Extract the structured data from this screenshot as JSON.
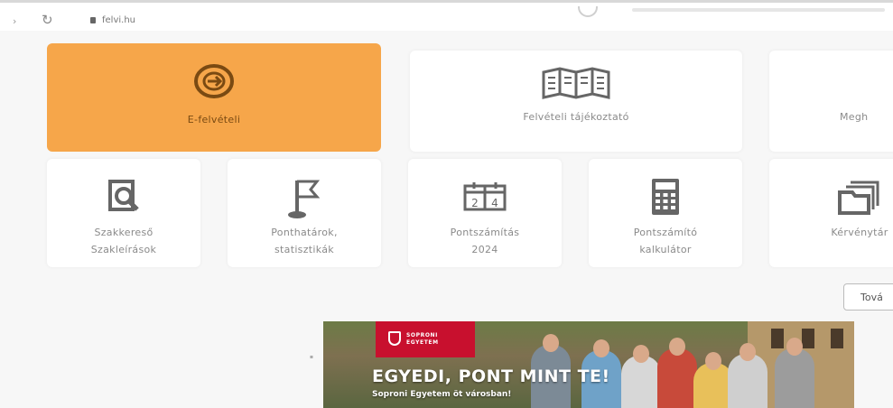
{
  "browser": {
    "url": "felvi.hu"
  },
  "tiles_row1": [
    {
      "label": "E-felvételi",
      "icon": "arrow-circle-icon"
    },
    {
      "label": "Felvételi tájékoztató",
      "icon": "open-book-icon"
    },
    {
      "label": "Megh",
      "icon": ""
    }
  ],
  "tiles_row2": [
    {
      "label_line1": "Szakkereső",
      "label_line2": "Szakleírások",
      "icon": "search-document-icon"
    },
    {
      "label_line1": "Ponthatárok,",
      "label_line2": "statisztikák",
      "icon": "flag-icon"
    },
    {
      "label_line1": "Pontszámítás",
      "label_line2": "2024",
      "icon": "calendar-icon"
    },
    {
      "label_line1": "Pontszámító",
      "label_line2": "kalkulátor",
      "icon": "calculator-icon"
    },
    {
      "label_line1": "Kérvénytár",
      "label_line2": "",
      "icon": "folder-stack-icon"
    }
  ],
  "more_button": {
    "label": "Tová"
  },
  "banner": {
    "brand_line1": "SOPRONI",
    "brand_line2": "EGYETEM",
    "headline": "EGYEDI, PONT MINT TE!",
    "subline": "Soproni Egyetem öt városban!"
  },
  "colors": {
    "primary_tile": "#f6a64a",
    "icon_gray": "#666666",
    "brand_red": "#c8102e"
  }
}
